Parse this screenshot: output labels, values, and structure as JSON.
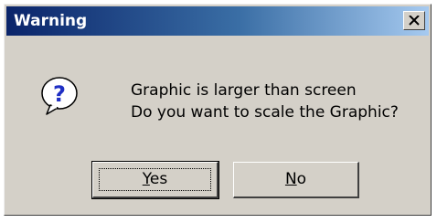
{
  "dialog": {
    "title": "Warning",
    "close_icon": "close-icon",
    "icon": "question-icon",
    "message_line1": "Graphic is larger than screen",
    "message_line2": "Do you want to scale the Graphic?",
    "buttons": {
      "yes": {
        "label_mnemonic": "Y",
        "label_rest": "es"
      },
      "no": {
        "label_mnemonic": "N",
        "label_rest": "o"
      }
    },
    "colors": {
      "titlebar_start": "#0a246a",
      "titlebar_end": "#a6caf0",
      "face": "#d4d0c8"
    }
  }
}
